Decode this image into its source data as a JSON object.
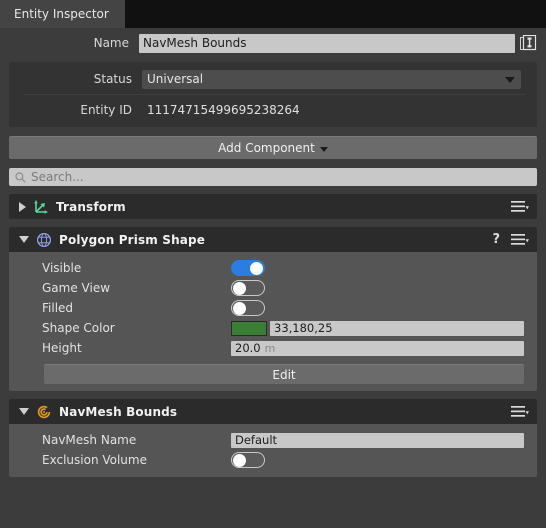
{
  "tab": {
    "label": "Entity Inspector"
  },
  "identity": {
    "name_label": "Name",
    "name_value": "NavMesh Bounds",
    "name_icon": "prefab-copy-icon",
    "status_label": "Status",
    "status_value": "Universal",
    "entity_id_label": "Entity ID",
    "entity_id_value": "11174715499695238264"
  },
  "add_component": {
    "label": "Add Component",
    "caret": "chevron-down-icon"
  },
  "search": {
    "placeholder": "Search...",
    "icon": "search-icon"
  },
  "components": [
    {
      "title": "Transform",
      "icon": "transform-axes-icon",
      "icon_color": "#5cd69a",
      "expanded": false,
      "has_help": false,
      "menu_icon": "hamburger-menu-icon"
    },
    {
      "title": "Polygon Prism Shape",
      "icon": "polygon-prism-icon",
      "icon_color": "#8f9fe8",
      "expanded": true,
      "has_help": true,
      "help_label": "?",
      "menu_icon": "hamburger-menu-icon",
      "rows": [
        {
          "label": "Visible",
          "type": "toggle",
          "value": true
        },
        {
          "label": "Game View",
          "type": "toggle",
          "value": false
        },
        {
          "label": "Filled",
          "type": "toggle",
          "value": false
        },
        {
          "label": "Shape Color",
          "type": "color",
          "value": "33,180,25",
          "swatch": "#3a7d35"
        },
        {
          "label": "Height",
          "type": "number",
          "value": "20.0",
          "unit": "m"
        }
      ],
      "button": {
        "label": "Edit"
      }
    },
    {
      "title": "NavMesh Bounds",
      "icon": "navmesh-swirl-icon",
      "icon_color": "#e29a1a",
      "expanded": true,
      "has_help": false,
      "menu_icon": "hamburger-menu-icon",
      "rows": [
        {
          "label": "NavMesh Name",
          "type": "text",
          "value": "Default"
        },
        {
          "label": "Exclusion Volume",
          "type": "toggle",
          "value": false
        }
      ]
    }
  ],
  "colors": {
    "toggle_on": "#2b7de1",
    "panel_bg": "#3c3c3c",
    "card_bg": "#555555",
    "card_header_bg": "#2b2b2b"
  }
}
